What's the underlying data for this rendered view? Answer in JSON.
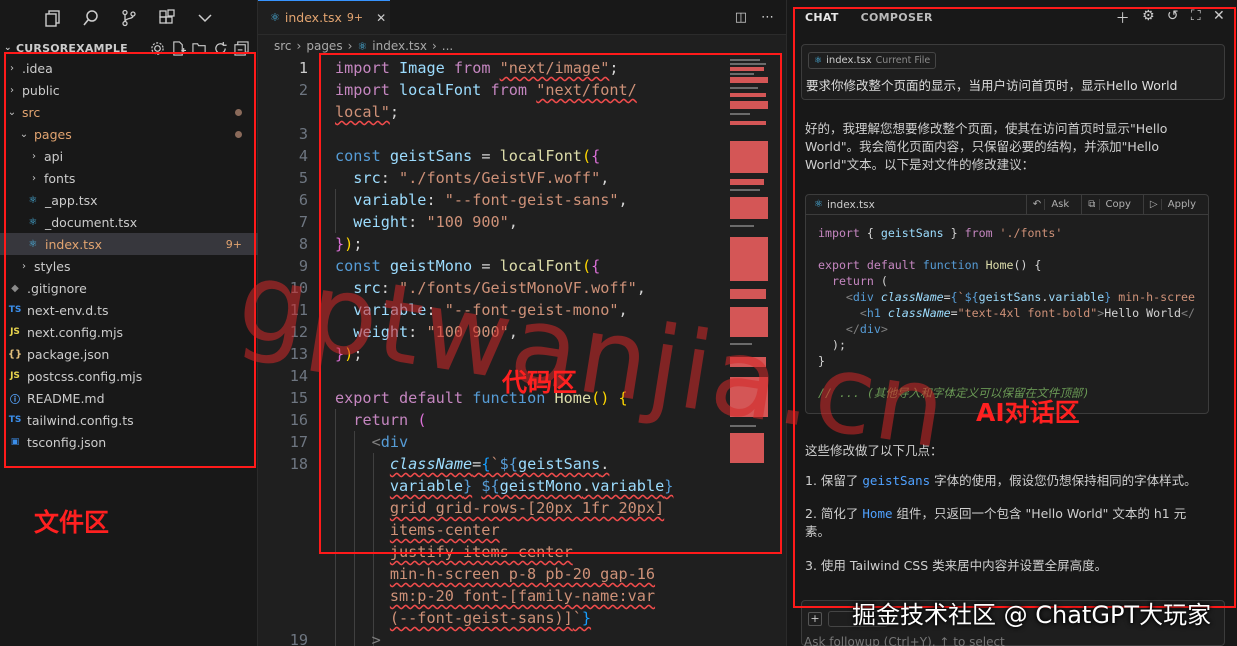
{
  "activity_bar": {
    "icons": [
      "files-icon",
      "search-icon",
      "source-control-icon",
      "extensions-icon",
      "more-chevron-icon"
    ]
  },
  "explorer": {
    "title": "CURSOREXAMPLE",
    "items": [
      {
        "label": ".idea",
        "type": "folder",
        "expanded": false,
        "depth": 0
      },
      {
        "label": "public",
        "type": "folder",
        "expanded": false,
        "depth": 0
      },
      {
        "label": "src",
        "type": "folder",
        "expanded": true,
        "depth": 0,
        "modified": true
      },
      {
        "label": "pages",
        "type": "folder",
        "expanded": true,
        "depth": 1,
        "modified": true
      },
      {
        "label": "api",
        "type": "folder",
        "expanded": false,
        "depth": 2
      },
      {
        "label": "fonts",
        "type": "folder",
        "expanded": false,
        "depth": 2
      },
      {
        "label": "_app.tsx",
        "type": "react",
        "depth": 2
      },
      {
        "label": "_document.tsx",
        "type": "react",
        "depth": 2
      },
      {
        "label": "index.tsx",
        "type": "react",
        "depth": 2,
        "selected": true,
        "badge": "9+"
      },
      {
        "label": "styles",
        "type": "folder",
        "expanded": false,
        "depth": 1
      },
      {
        "label": ".gitignore",
        "type": "git",
        "depth": 0
      },
      {
        "label": "next-env.d.ts",
        "type": "ts",
        "depth": 0
      },
      {
        "label": "next.config.mjs",
        "type": "js",
        "depth": 0
      },
      {
        "label": "package.json",
        "type": "json",
        "depth": 0
      },
      {
        "label": "postcss.config.mjs",
        "type": "js",
        "depth": 0
      },
      {
        "label": "README.md",
        "type": "info",
        "depth": 0
      },
      {
        "label": "tailwind.config.ts",
        "type": "ts",
        "depth": 0
      },
      {
        "label": "tsconfig.json",
        "type": "tsconfig",
        "depth": 0
      }
    ]
  },
  "editor": {
    "tab": {
      "label": "index.tsx",
      "badge": "9+"
    },
    "breadcrumb": [
      "src",
      "pages",
      "index.tsx",
      "..."
    ],
    "line_numbers": [
      "1",
      "2",
      "3",
      "4",
      "5",
      "6",
      "7",
      "8",
      "9",
      "10",
      "11",
      "12",
      "13",
      "14",
      "15",
      "16",
      "17",
      "18",
      "19"
    ]
  },
  "chat": {
    "tabs": [
      "CHAT",
      "COMPOSER"
    ],
    "user_message": {
      "file_chip": "index.tsx",
      "file_chip_note": "Current File",
      "text": "要求你修改整个页面的显示，当用户访问首页时，显示Hello World"
    },
    "ai_intro": "好的，我理解您想要修改整个页面，使其在访问首页时显示\"Hello World\"。我会简化页面内容，只保留必要的结构，并添加\"Hello World\"文本。以下是对文件的修改建议：",
    "code_block": {
      "file": "index.tsx",
      "actions": [
        "Ask",
        "Copy",
        "Apply"
      ]
    },
    "changes_intro": "这些修改做了以下几点：",
    "changes": [
      {
        "prefix": "1. 保留了",
        "code": "geistSans",
        "suffix": "字体的使用，假设您仍想保持相同的字体样式。"
      },
      {
        "prefix": "2. 简化了",
        "code": "Home",
        "suffix": "组件，只返回一个包含 \"Hello World\" 文本的 h1 元素。"
      },
      {
        "prefix": "3. 使用 Tailwind CSS 类来居中内容并设置全屏高度。",
        "code": "",
        "suffix": ""
      }
    ],
    "input_placeholder": "Ask followup (Ctrl+Y), ↑ to select"
  },
  "annotations": {
    "files_label": "文件区",
    "code_label": "代码区",
    "ai_label": "AI对话区",
    "box_color": "#ff1a1a"
  },
  "watermark": "gptwanjia.cn",
  "credit": "掘金技术社区 @ ChatGPT大玩家"
}
